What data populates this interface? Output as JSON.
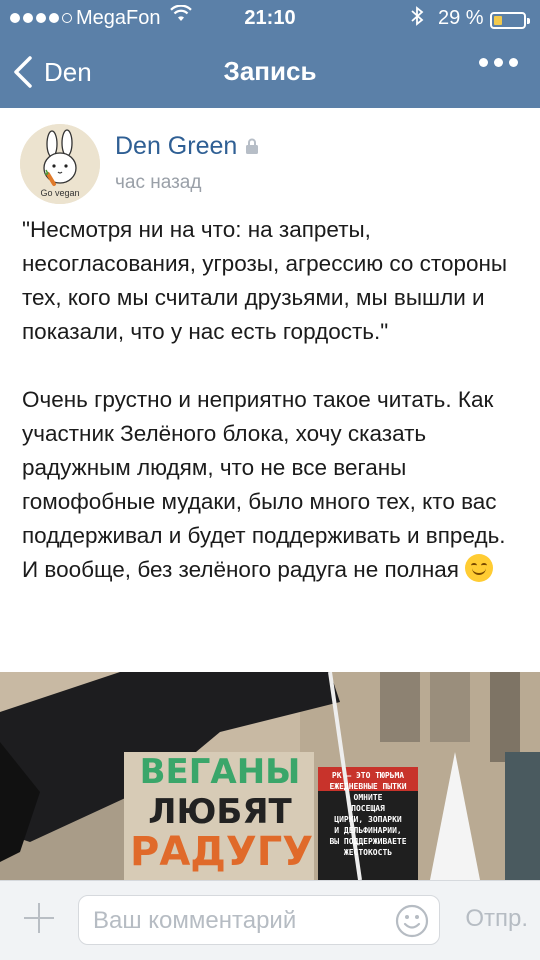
{
  "status_bar": {
    "carrier": "MegaFon",
    "time": "21:10",
    "battery_pct": "29 %",
    "battery_level": 0.29
  },
  "nav": {
    "back_label": "Den",
    "title": "Запись"
  },
  "post": {
    "author": "Den Green",
    "time_ago": "час назад",
    "avatar_caption": "Go vegan",
    "paragraphs": [
      "\"Несмотря ни на что: на запреты, несогласования, угрозы, агрессию со стороны тех, кого мы считали друзьями, мы вышли и показали, что у нас есть гордость.\"",
      "Очень грустно и неприятно такое читать. Как участник Зелёного блока, хочу сказать радужным людям, что не все веганы гомофобные мудаки, было много тех, кто вас поддерживал и будет поддерживать и впредь. И вообще, без зелёного радуга не полная"
    ]
  },
  "photo": {
    "sign_lines": [
      "ВЕГАНЫ",
      "ЛЮБЯТ",
      "РАДУГУ"
    ],
    "poster_lines": [
      "РК – ЭТО ТЮРЬМА",
      "ЕЖЕДНЕВНЫЕ ПЫТКИ",
      "ОМНИТЕ",
      "ПОСЕЩАЯ",
      "ЦИРКИ, ЗОПАРКИ",
      "И ДЕЛЬФИНАРИИ,",
      "ВЫ ПОДДЕРЖИВАЕТЕ",
      "ЖЕСТОКОСТЬ"
    ]
  },
  "comment_bar": {
    "placeholder": "Ваш комментарий",
    "send_label": "Отпр."
  },
  "colors": {
    "nav_bg": "#5b80a8",
    "author": "#2f5f94",
    "muted": "#9aa0a8"
  }
}
